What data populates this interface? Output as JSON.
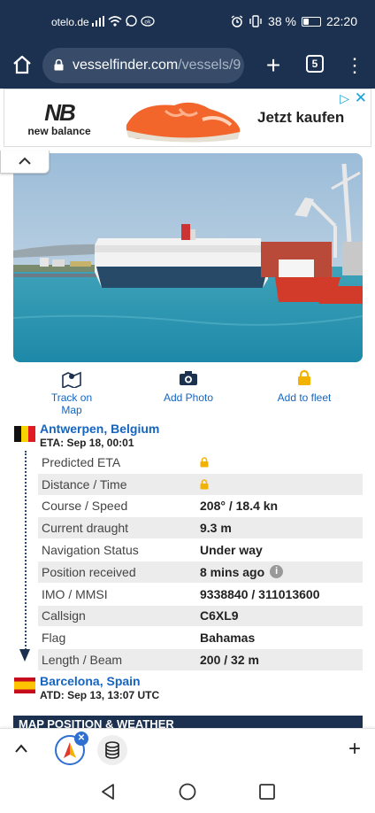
{
  "status_bar": {
    "carrier": "otelo.de",
    "battery_percent": "38 %",
    "battery_level": 0.38,
    "time": "22:20"
  },
  "browser": {
    "url_domain": "vesselfinder.com",
    "url_path": "/vessels/9",
    "tab_count": "5"
  },
  "ad": {
    "brand": "new balance",
    "cta": "Jetzt kaufen"
  },
  "actions": {
    "track": "Track on Map",
    "photo": "Add Photo",
    "fleet": "Add to fleet"
  },
  "destination": {
    "name": "Antwerpen, Belgium",
    "eta": "ETA: Sep 18, 00:01"
  },
  "origin": {
    "name": "Barcelona, Spain",
    "atd": "ATD: Sep 13, 13:07 UTC"
  },
  "details": [
    {
      "key": "Predicted ETA",
      "value": ""
    },
    {
      "key": "Distance / Time",
      "value": ""
    },
    {
      "key": "Course / Speed",
      "value": "208° / 18.4 kn"
    },
    {
      "key": "Current draught",
      "value": "9.3 m"
    },
    {
      "key": "Navigation Status",
      "value": "Under way"
    },
    {
      "key": "Position received",
      "value": "8 mins ago"
    },
    {
      "key": "IMO / MMSI",
      "value": "9338840 / 311013600"
    },
    {
      "key": "Callsign",
      "value": "C6XL9"
    },
    {
      "key": "Flag",
      "value": "Bahamas"
    },
    {
      "key": "Length / Beam",
      "value": "200 / 32 m"
    }
  ],
  "map_section": {
    "title": "MAP POSITION & WEATHER"
  },
  "colors": {
    "header_bg": "#1c3150",
    "link_blue": "#1565c0",
    "lock_yellow": "#f2b300"
  }
}
